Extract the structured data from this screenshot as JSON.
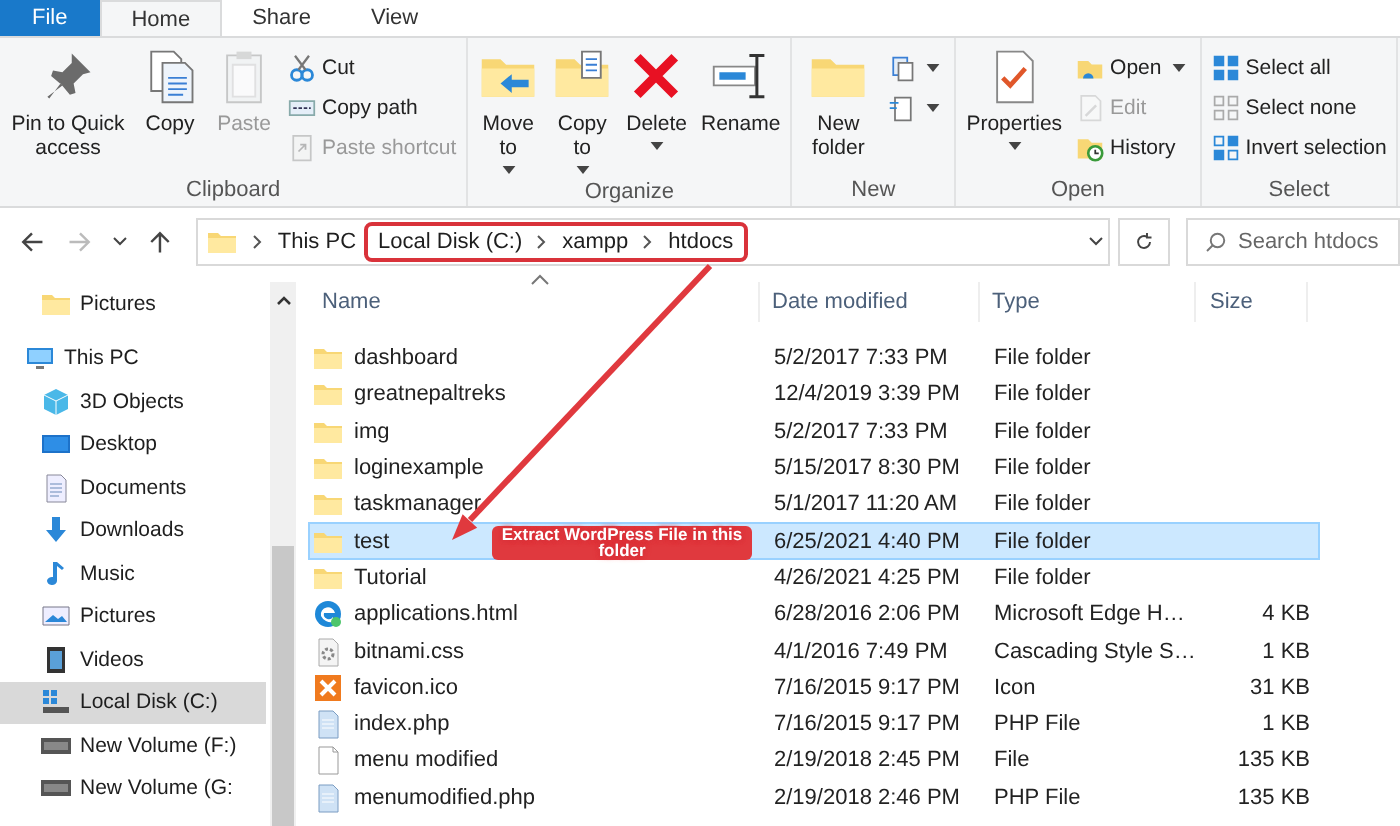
{
  "ribbon_tabs": [
    {
      "label": "File",
      "selected": false,
      "kind": "file"
    },
    {
      "label": "Home",
      "selected": true,
      "kind": "tab"
    },
    {
      "label": "Share",
      "selected": false,
      "kind": "tab"
    },
    {
      "label": "View",
      "selected": false,
      "kind": "tab"
    }
  ],
  "ribbon": {
    "groups": [
      {
        "label": "Clipboard",
        "large": [
          {
            "label": "Pin to Quick access",
            "disabled": false,
            "menu": false
          },
          {
            "label": "Copy",
            "disabled": false,
            "menu": false
          },
          {
            "label": "Paste",
            "disabled": true,
            "menu": false
          }
        ],
        "small": [
          {
            "label": "Cut",
            "disabled": false,
            "menu": false
          },
          {
            "label": "Copy path",
            "disabled": false,
            "menu": false
          },
          {
            "label": "Paste shortcut",
            "disabled": true,
            "menu": false
          }
        ]
      },
      {
        "label": "Organize",
        "large": [
          {
            "label": "Move to",
            "disabled": false,
            "menu": true
          },
          {
            "label": "Copy to",
            "disabled": false,
            "menu": true
          },
          {
            "label": "Delete",
            "disabled": false,
            "menu": true
          },
          {
            "label": "Rename",
            "disabled": false,
            "menu": false
          }
        ]
      },
      {
        "label": "New",
        "large": [
          {
            "label": "New folder",
            "disabled": false,
            "menu": false
          }
        ],
        "small": [
          {
            "disabled": false,
            "menu": true
          },
          {
            "disabled": false,
            "menu": true
          }
        ]
      },
      {
        "label": "Open",
        "large": [
          {
            "label": "Properties",
            "disabled": false,
            "menu": true
          }
        ],
        "small": [
          {
            "label": "Open",
            "disabled": false,
            "menu": true
          },
          {
            "label": "Edit",
            "disabled": true,
            "menu": false
          },
          {
            "label": "History",
            "disabled": false,
            "menu": false
          }
        ]
      },
      {
        "label": "Select",
        "small": [
          {
            "label": "Select all",
            "disabled": false,
            "menu": false
          },
          {
            "label": "Select none",
            "disabled": false,
            "menu": false
          },
          {
            "label": "Invert selection",
            "disabled": false,
            "menu": false
          }
        ]
      }
    ]
  },
  "address": {
    "crumbs": [
      {
        "label": "This PC",
        "highlighted": false
      },
      {
        "label": "Local Disk (C:)",
        "highlighted": true
      },
      {
        "label": "xampp",
        "highlighted": true
      },
      {
        "label": "htdocs",
        "highlighted": true
      }
    ],
    "search": {
      "placeholder": "Search htdocs"
    }
  },
  "sidebar": {
    "items": [
      {
        "label": "Pictures",
        "kind": "folder",
        "selected": false
      },
      {
        "label": "This PC",
        "kind": "pc",
        "selected": false,
        "children": [
          {
            "label": "3D Objects",
            "kind": "cube",
            "selected": false
          },
          {
            "label": "Desktop",
            "kind": "desktop",
            "selected": false
          },
          {
            "label": "Documents",
            "kind": "documents",
            "selected": false
          },
          {
            "label": "Downloads",
            "kind": "download",
            "selected": false
          },
          {
            "label": "Music",
            "kind": "music",
            "selected": false
          },
          {
            "label": "Pictures",
            "kind": "pictures",
            "selected": false
          },
          {
            "label": "Videos",
            "kind": "videos",
            "selected": false
          },
          {
            "label": "Local Disk (C:)",
            "kind": "windrive",
            "selected": true
          },
          {
            "label": "New Volume (F:)",
            "kind": "drive",
            "selected": false
          },
          {
            "label": "New Volume (G:",
            "kind": "drive",
            "selected": false
          }
        ]
      }
    ]
  },
  "table": {
    "columns": [
      "Name",
      "Date modified",
      "Type",
      "Size"
    ],
    "rows": [
      {
        "kind": "folder",
        "name": "dashboard",
        "date": "5/2/2017 7:33 PM",
        "type": "File folder",
        "size": "",
        "selected": false
      },
      {
        "kind": "folder",
        "name": "greatnepaltreks",
        "date": "12/4/2019 3:39 PM",
        "type": "File folder",
        "size": "",
        "selected": false
      },
      {
        "kind": "folder",
        "name": "img",
        "date": "5/2/2017 7:33 PM",
        "type": "File folder",
        "size": "",
        "selected": false
      },
      {
        "kind": "folder",
        "name": "loginexample",
        "date": "5/15/2017 8:30 PM",
        "type": "File folder",
        "size": "",
        "selected": false
      },
      {
        "kind": "folder",
        "name": "taskmanager",
        "date": "5/1/2017 11:20 AM",
        "type": "File folder",
        "size": "",
        "selected": false
      },
      {
        "kind": "folder",
        "name": "test",
        "date": "6/25/2021 4:40 PM",
        "type": "File folder",
        "size": "",
        "selected": true
      },
      {
        "kind": "folder",
        "name": "Tutorial",
        "date": "4/26/2021 4:25 PM",
        "type": "File folder",
        "size": "",
        "selected": false
      },
      {
        "kind": "edge",
        "name": "applications.html",
        "date": "6/28/2016 2:06 PM",
        "type": "Microsoft Edge H…",
        "size": "4 KB",
        "selected": false
      },
      {
        "kind": "css",
        "name": "bitnami.css",
        "date": "4/1/2016 7:49 PM",
        "type": "Cascading Style S…",
        "size": "1 KB",
        "selected": false
      },
      {
        "kind": "xampp",
        "name": "favicon.ico",
        "date": "7/16/2015 9:17 PM",
        "type": "Icon",
        "size": "31 KB",
        "selected": false
      },
      {
        "kind": "php",
        "name": "index.php",
        "date": "7/16/2015 9:17 PM",
        "type": "PHP File",
        "size": "1 KB",
        "selected": false
      },
      {
        "kind": "file",
        "name": "menu modified",
        "date": "2/19/2018 2:45 PM",
        "type": "File",
        "size": "135 KB",
        "selected": false
      },
      {
        "kind": "php",
        "name": "menumodified.php",
        "date": "2/19/2018 2:46 PM",
        "type": "PHP File",
        "size": "135 KB",
        "selected": false
      }
    ]
  },
  "annotation": {
    "label": "Extract WordPress File in this folder"
  }
}
